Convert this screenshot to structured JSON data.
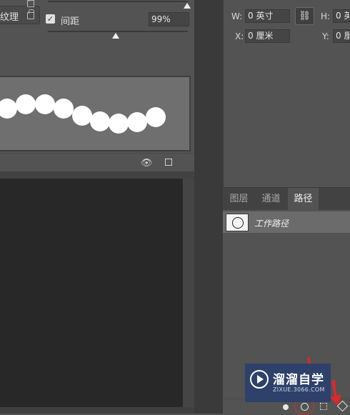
{
  "brush_settings": {
    "texture_label": "纹理",
    "spacing_checked": true,
    "spacing_label": "间距",
    "spacing_value": "99%",
    "slider_top_level": 1.0,
    "spacing_slider_level": 0.48
  },
  "properties": {
    "w_label": "W:",
    "w_value": "0 英寸",
    "h_label": "H:",
    "h_value": "0 英",
    "x_label": "X:",
    "x_value": "0 厘米",
    "y_label": "Y:",
    "y_value": "0 厘",
    "link_icon": "chain-link-icon"
  },
  "tabs": [
    {
      "label": "图层",
      "active": false
    },
    {
      "label": "通道",
      "active": false
    },
    {
      "label": "路径",
      "active": true
    }
  ],
  "paths": {
    "items": [
      {
        "name": "工作路径"
      }
    ]
  },
  "watermark": {
    "title": "溜溜自学",
    "url": "ZIXUE.3066.COM"
  },
  "colors": {
    "panel": "#535353",
    "dark": "#3a3a3a",
    "canvas": "#282828",
    "accent_red": "#e0272b",
    "watermark_bg": "#2a3f6c"
  }
}
